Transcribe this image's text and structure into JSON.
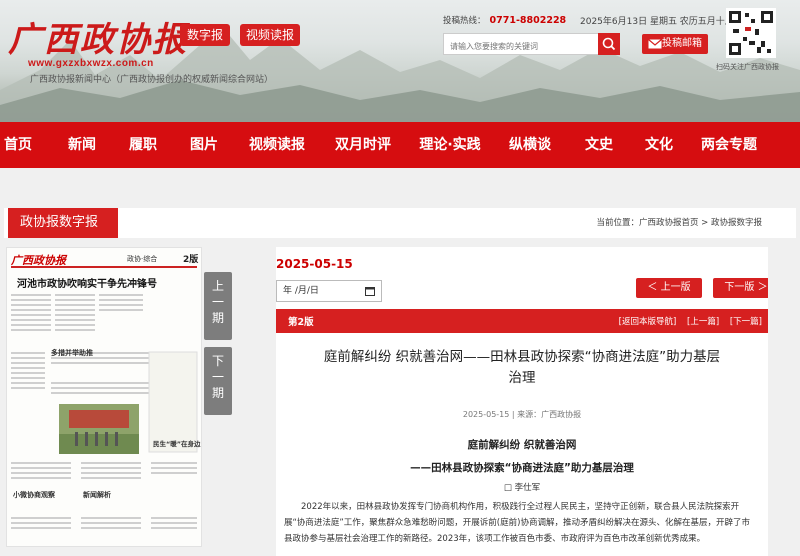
{
  "header": {
    "logo_text": "广西政协报",
    "logo_url": "www.gxzxbxwzx.com.cn",
    "logo_subtitle": "广西政协报新闻中心（广西政协报创办的权威新闻综合网站）",
    "btn_digital": "数字报",
    "btn_video": "视频读报",
    "hotline_label": "投稿热线：",
    "hotline_number": "0771-8802228",
    "date_text": "2025年6月13日 星期五 农历五月十八",
    "search_placeholder": "请输入您要搜索的关键词",
    "tougao_label": "投稿邮箱",
    "qr_caption": "扫码关注广西政协报"
  },
  "nav": [
    "首页",
    "新闻",
    "履职",
    "图片",
    "视频读报",
    "双月时评",
    "理论·实践",
    "纵横谈",
    "文史",
    "文化",
    "两会专题"
  ],
  "section": {
    "title": "政协报数字报",
    "breadcrumb": "当前位置：广西政协报首页 > 政协报数字报"
  },
  "paper": {
    "masthead": "广西政协报",
    "page_tag": "政协·综合",
    "page_no": "2版",
    "headline": "河池市政协吹响实干争先冲锋号",
    "sub1": "多措并举助推",
    "sub2": "民生“暖”在身边",
    "sub3": "小微协商观察",
    "sub4": "新闻解析"
  },
  "pager": {
    "prev": [
      "上",
      "一",
      "期"
    ],
    "next": [
      "下",
      "一",
      "期"
    ]
  },
  "main": {
    "issue_date": "2025-05-15",
    "date_input_value": "年 /月/日",
    "prev_version": "＜ 上一版",
    "next_version": "下一版 ＞",
    "page_label": "第2版",
    "links": [
      "[返回本版导航]",
      "[上一篇]",
      "[下一篇]"
    ],
    "title_line1": "庭前解纠纷 织就善治网——田林县政协探索“协商进法庭”助力基层",
    "title_line2": "治理",
    "meta": "2025-05-15 | 来源：广西政协报",
    "heading1": "庭前解纠纷 织就善治网",
    "heading2": "——田林县政协探索“协商进法庭”助力基层治理",
    "author": "□ 李仕军",
    "body": "2022年以来，田林县政协发挥专门协商机构作用，积极践行全过程人民民主，坚持守正创新，联合县人民法院探索开展“协商进法庭”工作，聚焦群众急难愁盼问题，开展诉前(庭前)协商调解，推动矛盾纠纷解决在源头、化解在基层，开辟了市县政协参与基层社会治理工作的新路径。2023年，该项工作被百色市委、市政府评为百色市改革创新优秀成果。"
  },
  "colors": {
    "brand_red": "#d60d10",
    "button_red": "#d62020",
    "pager_gray": "#7d7d7d"
  }
}
